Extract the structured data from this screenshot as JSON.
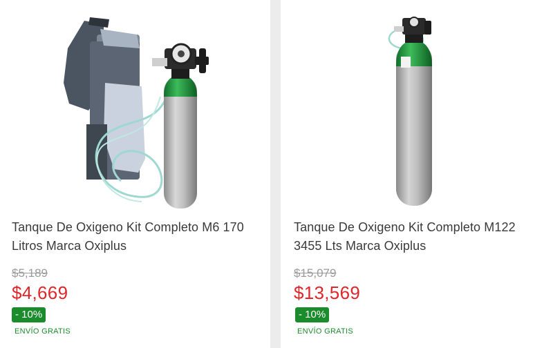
{
  "products": [
    {
      "title_line1": "Tanque De Oxigeno Kit Completo M6 170",
      "title_line2": "Litros Marca Oxiplus",
      "old_price": "$5,189",
      "price": "$4,669",
      "discount": "- 10%",
      "shipping": "ENVÍO GRATIS"
    },
    {
      "title_line1": "Tanque De Oxigeno Kit Completo M122",
      "title_line2": "3455 Lts Marca Oxiplus",
      "old_price": "$15,079",
      "price": "$13,569",
      "discount": "- 10%",
      "shipping": "ENVÍO GRATIS"
    }
  ],
  "colors": {
    "price_red": "#e0262a",
    "discount_green": "#1a8c2c",
    "old_price_gray": "#9a9a9a",
    "title_text": "#3a3a3a",
    "page_background": "#ececec"
  }
}
